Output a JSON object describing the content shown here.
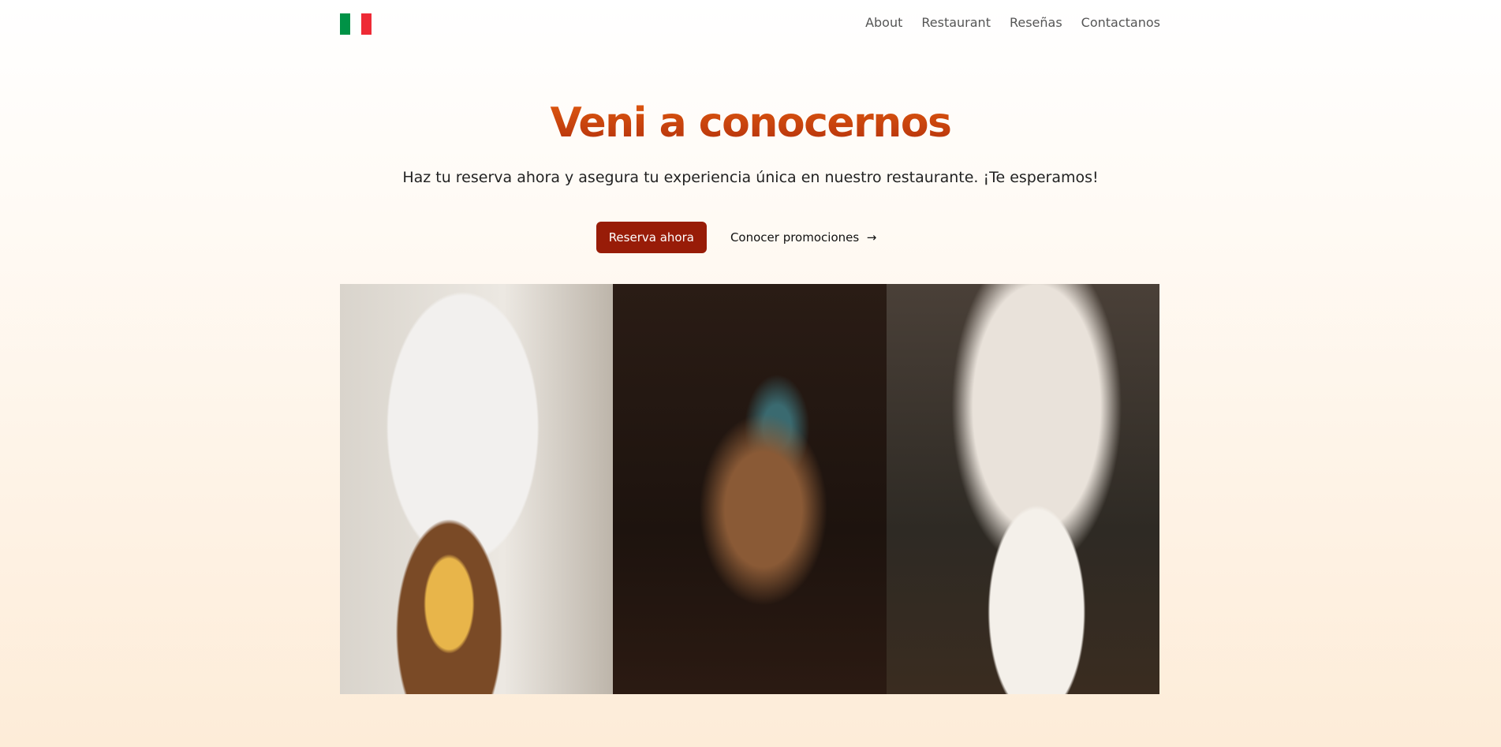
{
  "header": {
    "logo": {
      "icon": "italy-flag-icon",
      "colors": [
        "#009246",
        "#ffffff",
        "#ce2b37"
      ]
    },
    "nav": [
      {
        "label": "About"
      },
      {
        "label": "Restaurant"
      },
      {
        "label": "Reseñas"
      },
      {
        "label": "Contactanos"
      }
    ]
  },
  "hero": {
    "title": "Veni a conocernos",
    "subtitle": "Haz tu reserva ahora y asegura tu experiencia única en nuestro restaurante. ¡Te esperamos!",
    "primary_button": "Reserva ahora",
    "secondary_button": "Conocer promociones",
    "secondary_icon": "arrow-right-icon",
    "accent_color": "#981c08"
  },
  "gallery": [
    {
      "subject": "chef-cutting-pizza-photo"
    },
    {
      "subject": "restaurant-table-cocktails-photo"
    },
    {
      "subject": "chef-plating-pasta-photo"
    }
  ]
}
